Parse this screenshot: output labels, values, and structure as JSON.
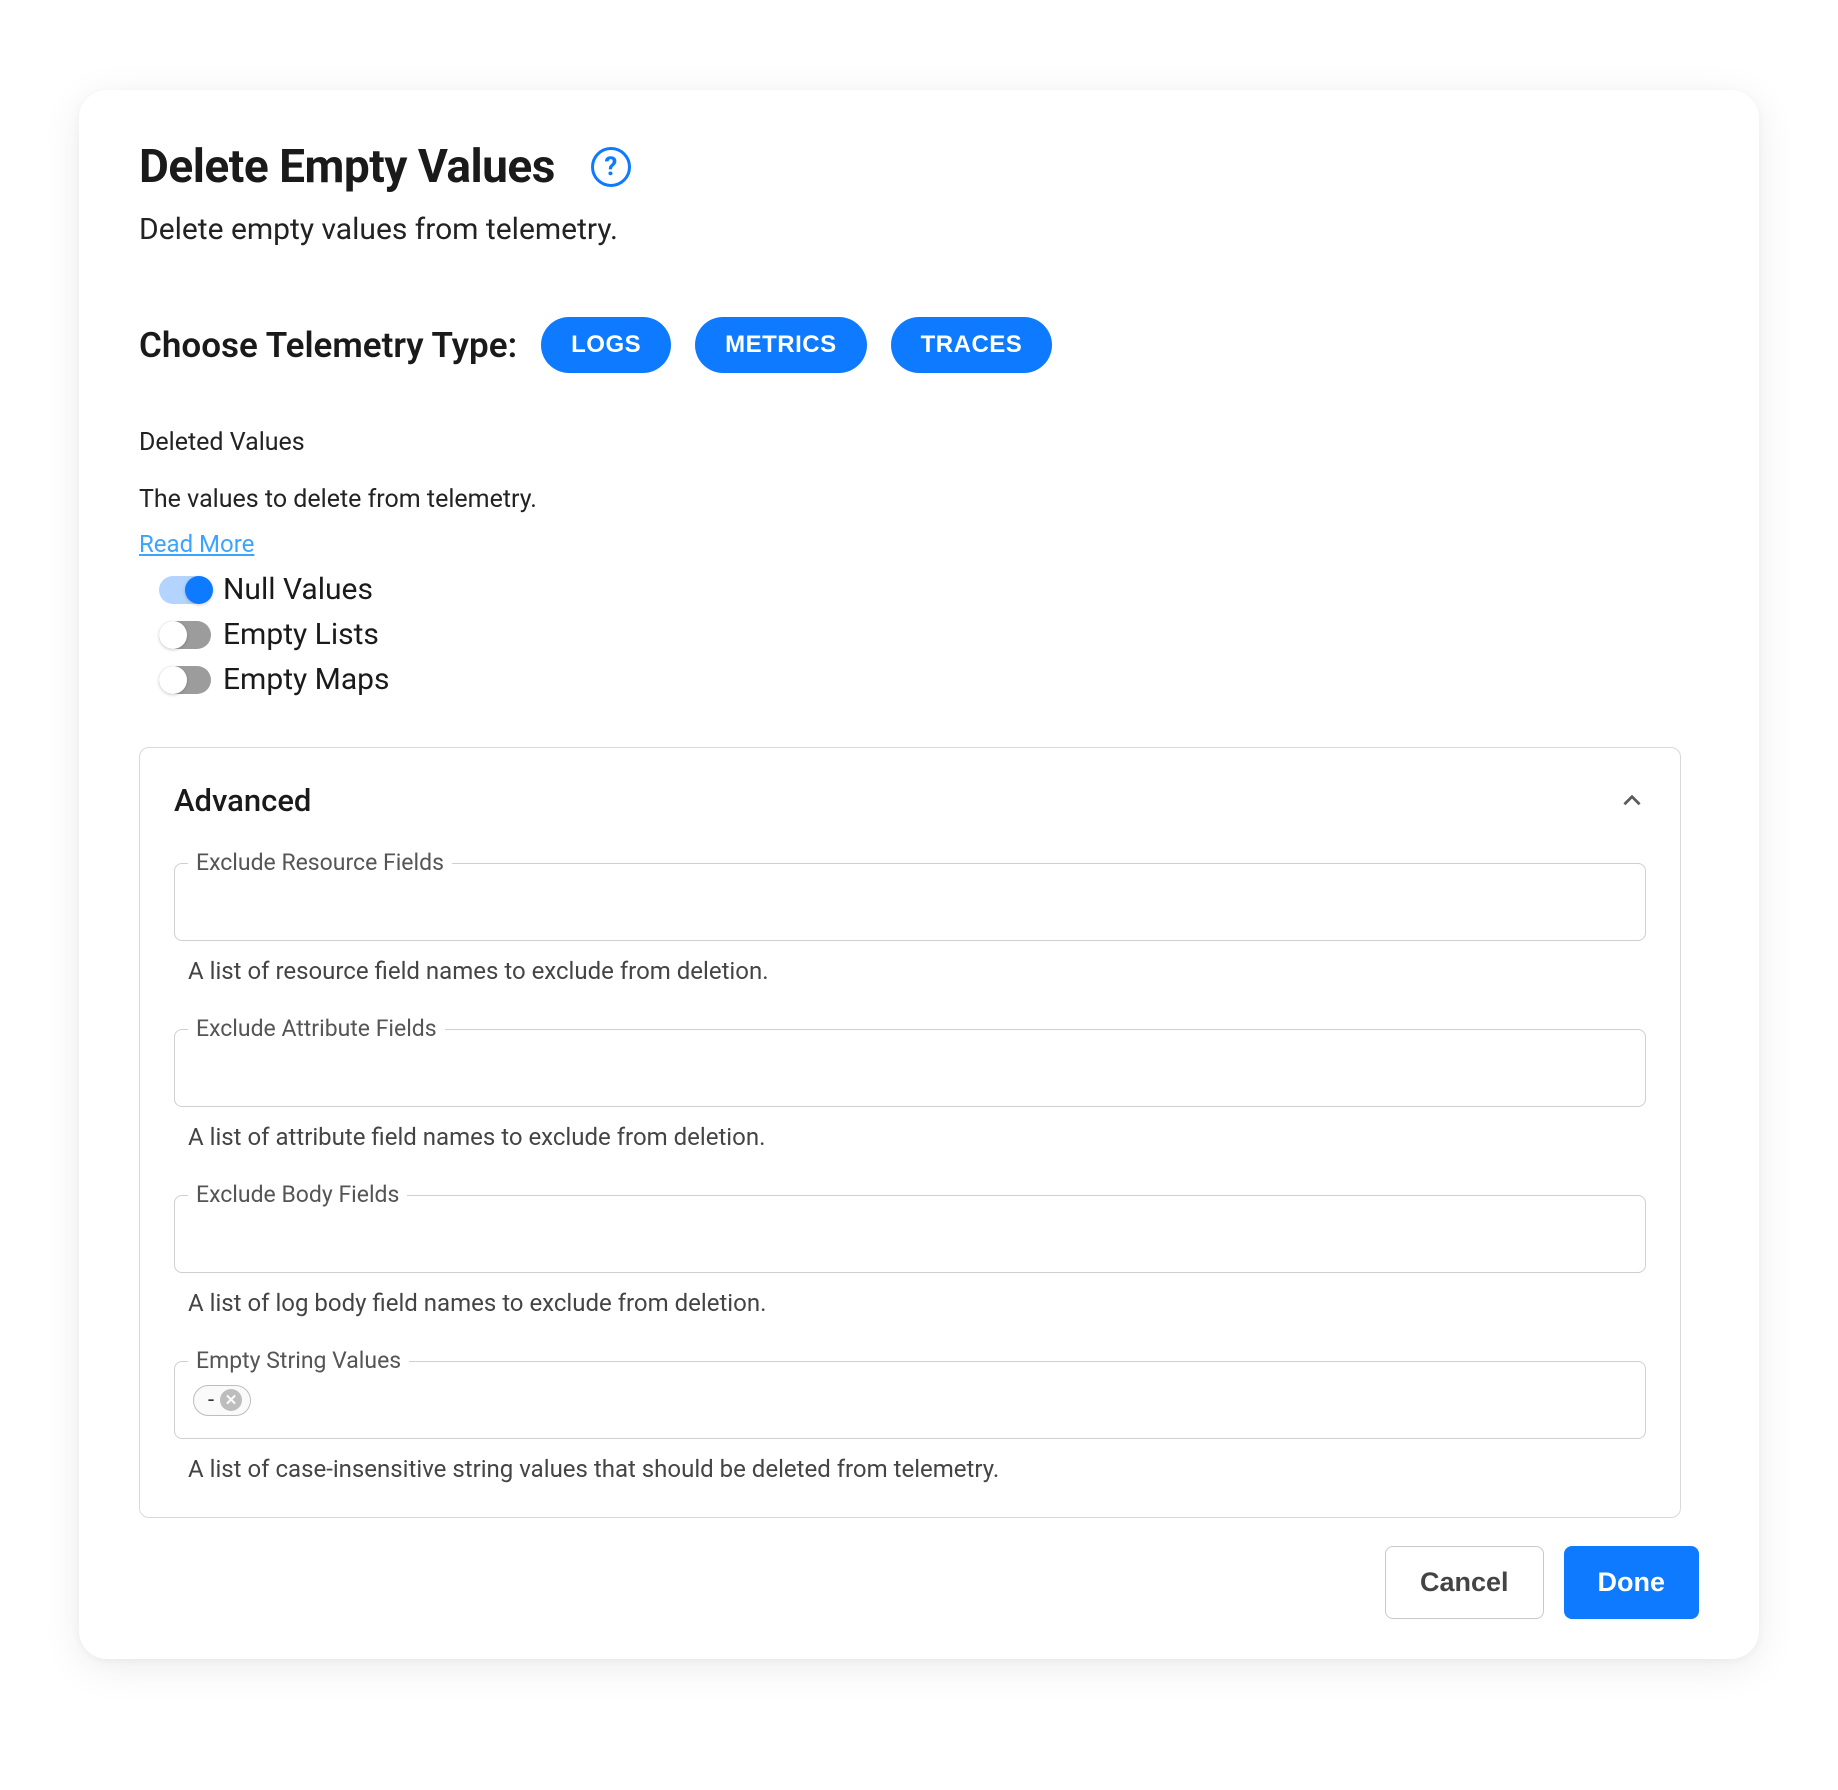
{
  "header": {
    "title": "Delete Empty Values",
    "subtitle": "Delete empty values from telemetry."
  },
  "telemetry": {
    "label": "Choose Telemetry Type:",
    "types": [
      "LOGS",
      "METRICS",
      "TRACES"
    ]
  },
  "deleted_values": {
    "heading": "Deleted Values",
    "description": "The values to delete from telemetry.",
    "read_more": "Read More",
    "options": [
      {
        "label": "Null Values",
        "on": true
      },
      {
        "label": "Empty Lists",
        "on": false
      },
      {
        "label": "Empty Maps",
        "on": false
      }
    ]
  },
  "advanced": {
    "title": "Advanced",
    "expanded": true,
    "fields": [
      {
        "legend": "Exclude Resource Fields",
        "help": "A list of resource field names to exclude from deletion.",
        "chips": []
      },
      {
        "legend": "Exclude Attribute Fields",
        "help": "A list of attribute field names to exclude from deletion.",
        "chips": []
      },
      {
        "legend": "Exclude Body Fields",
        "help": "A list of log body field names to exclude from deletion.",
        "chips": []
      },
      {
        "legend": "Empty String Values",
        "help": "A list of case-insensitive string values that should be deleted from telemetry.",
        "chips": [
          "-"
        ]
      }
    ]
  },
  "footer": {
    "cancel": "Cancel",
    "done": "Done"
  }
}
